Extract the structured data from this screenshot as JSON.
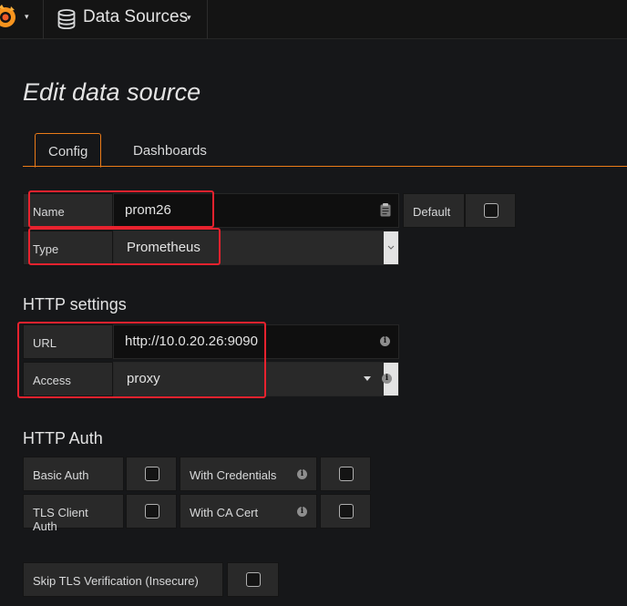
{
  "topbar": {
    "section_label": "Data Sources"
  },
  "page": {
    "title": "Edit data source"
  },
  "tabs": [
    {
      "label": "Config",
      "active": true
    },
    {
      "label": "Dashboards",
      "active": false
    }
  ],
  "basic": {
    "name_label": "Name",
    "name_value": "prom26",
    "default_label": "Default",
    "default_checked": false,
    "type_label": "Type",
    "type_value": "Prometheus"
  },
  "http": {
    "title": "HTTP settings",
    "url_label": "URL",
    "url_value": "http://10.0.20.26:9090",
    "access_label": "Access",
    "access_value": "proxy"
  },
  "auth": {
    "title": "HTTP Auth",
    "basic_auth_label": "Basic Auth",
    "with_credentials_label": "With Credentials",
    "tls_client_auth_label": "TLS Client Auth",
    "with_ca_cert_label": "With CA Cert",
    "skip_tls_label": "Skip TLS Verification (Insecure)"
  },
  "colors": {
    "accent": "#eb7b18",
    "highlight": "#e8222e",
    "background": "#161719"
  }
}
